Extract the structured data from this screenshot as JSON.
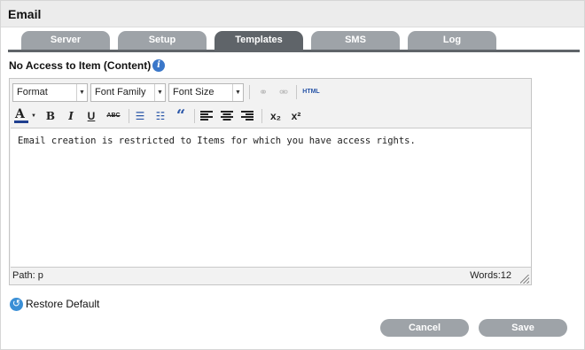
{
  "window": {
    "title": "Email"
  },
  "tabs": [
    {
      "label": "Server",
      "active": false
    },
    {
      "label": "Setup",
      "active": false
    },
    {
      "label": "Templates",
      "active": true
    },
    {
      "label": "SMS",
      "active": false
    },
    {
      "label": "Log",
      "active": false
    }
  ],
  "section": {
    "title": "No Access to Item (Content)",
    "info_icon": "i"
  },
  "editor": {
    "toolbar": {
      "format_select": "Format",
      "font_family_select": "Font Family",
      "font_size_select": "Font Size",
      "html_label": "HTML",
      "icons": {
        "link": "⚭",
        "unlink": "⚮",
        "font_color": "A",
        "bold": "B",
        "italic": "I",
        "underline": "U",
        "strike": "ABC",
        "bullets": "☰",
        "numbers": "☷",
        "quote": "“",
        "subscript": "x₂",
        "superscript": "x²",
        "dropdown": "▼"
      }
    },
    "content": "Email creation is restricted to Items for which you have access rights.",
    "status": {
      "path": "Path: p",
      "words": "Words:12"
    }
  },
  "restore_default": {
    "label": "Restore Default",
    "icon": "↺"
  },
  "buttons": {
    "cancel": "Cancel",
    "save": "Save"
  },
  "colors": {
    "tab_inactive": "#9ea3a8",
    "tab_active": "#5f6469",
    "info_blue": "#3a77c9",
    "font_color_bar": "#1f3f8f"
  }
}
